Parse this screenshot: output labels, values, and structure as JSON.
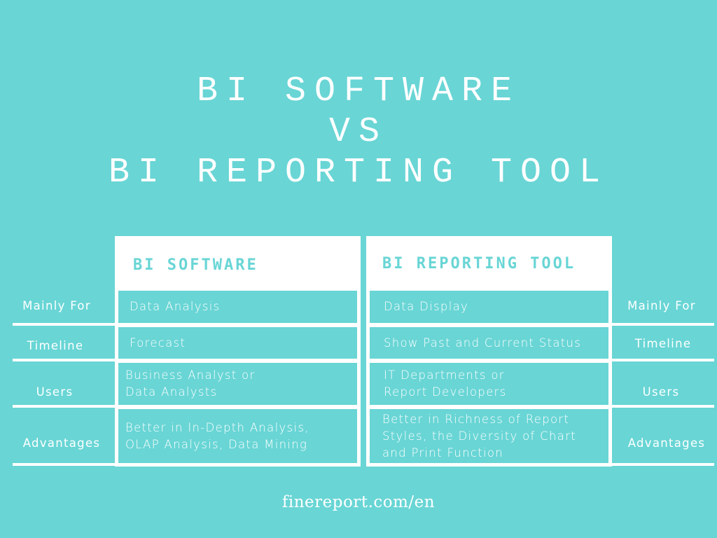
{
  "title": {
    "line1": "BI SOFTWARE",
    "line2": "VS",
    "line3": "BI REPORTING TOOL"
  },
  "left_table": {
    "header": "BI SOFTWARE",
    "rows": [
      {
        "label": "Mainly For",
        "value": "Data Analysis"
      },
      {
        "label": "Timeline",
        "value": "Forecast"
      },
      {
        "label": "Users",
        "value": "Business Analyst or\nData Analysts"
      },
      {
        "label": "Advantages",
        "value": "Better in In-Depth Analysis,\nOLAP Analysis, Data Mining"
      }
    ]
  },
  "right_table": {
    "header": "BI REPORTING TOOL",
    "rows": [
      {
        "label": "Mainly For",
        "value": "Data Display"
      },
      {
        "label": "Timeline",
        "value": "Show Past and Current Status"
      },
      {
        "label": "Users",
        "value": "IT Departments or\nReport Developers"
      },
      {
        "label": "Advantages",
        "value": "Better in Richness of Report\nStyles, the Diversity of Chart\nand Print Function"
      }
    ]
  },
  "footer": "finereport.com/en",
  "colors": {
    "background": "#69D5D5",
    "frame": "#FFFFFF",
    "text": "#FFFFFF"
  }
}
